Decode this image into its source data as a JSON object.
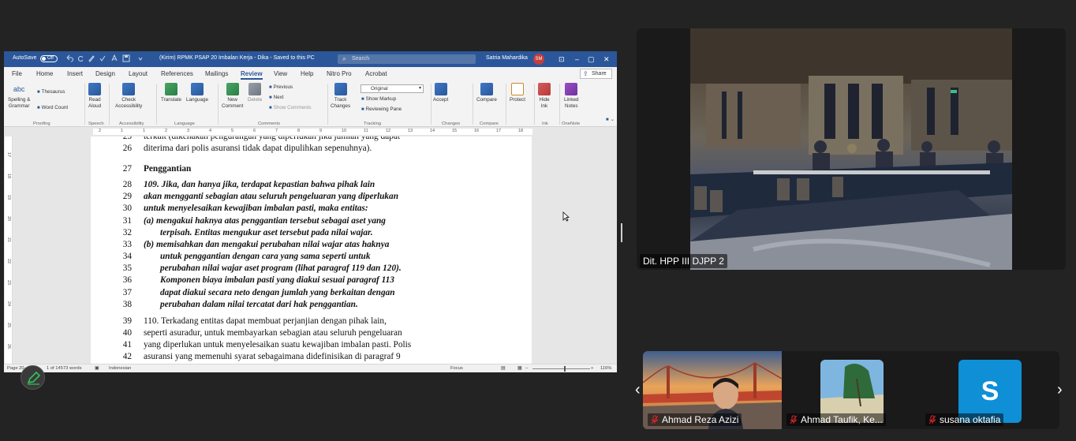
{
  "word": {
    "titlebar": {
      "autosave_label": "AutoSave",
      "autosave_state": "Off",
      "doc_title": "(Kirim) RPMK PSAP 20 Imbalan Kerja - Dika  -  Saved to this PC",
      "search_placeholder": "Search",
      "user_name": "Satria Mahardika",
      "user_initials": "SM"
    },
    "tabs": [
      "File",
      "Home",
      "Insert",
      "Design",
      "Layout",
      "References",
      "Mailings",
      "Review",
      "View",
      "Help",
      "Nitro Pro",
      "Acrobat"
    ],
    "active_tab": "Review",
    "share_label": "Share",
    "ribbon": {
      "proofing": {
        "spelling": "Spelling &",
        "spelling2": "Grammar",
        "thesaurus": "Thesaurus",
        "word_count": "Word Count",
        "group": "Proofing"
      },
      "speech": {
        "read_aloud": "Read",
        "read_aloud2": "Aloud",
        "group": "Speech"
      },
      "accessibility": {
        "check": "Check",
        "check2": "Accessibility",
        "group": "Accessibility"
      },
      "language": {
        "translate": "Translate",
        "language": "Language",
        "group": "Language"
      },
      "comments": {
        "new_comment": "New",
        "new_comment2": "Comment",
        "delete": "Delete",
        "previous": "Previous",
        "next": "Next",
        "show_comments": "Show Comments",
        "group": "Comments"
      },
      "tracking": {
        "track_changes": "Track",
        "track_changes2": "Changes",
        "markup_view": "Original",
        "show_markup": "Show Markup",
        "reviewing_pane": "Reviewing Pane",
        "group": "Tracking"
      },
      "changes": {
        "accept": "Accept",
        "group": "Changes"
      },
      "compare": {
        "compare": "Compare",
        "group": "Compare"
      },
      "protect": {
        "protect": "Protect"
      },
      "ink": {
        "hide_ink": "Hide",
        "hide_ink2": "Ink",
        "group": "Ink"
      },
      "onenote": {
        "linked_notes": "Linked",
        "linked_notes2": "Notes",
        "group": "OneNote"
      }
    },
    "ruler_ticks": [
      "2",
      "1",
      "1",
      "2",
      "3",
      "4",
      "5",
      "6",
      "7",
      "8",
      "9",
      "10",
      "11",
      "12",
      "13",
      "14",
      "15",
      "16",
      "17",
      "18"
    ],
    "vruler_ticks": [
      "17",
      "18",
      "19",
      "20",
      "21",
      "22",
      "23",
      "24",
      "25",
      "26"
    ],
    "document": {
      "lines": [
        {
          "n": "25",
          "t": "terkait (dikenakan pengurangan yang diperlukan jika jumlah yang dapat",
          "style": "",
          "indent": false
        },
        {
          "n": "26",
          "t": "diterima dari polis asuransi tidak dapat dipulihkan sepenuhnya).",
          "style": "",
          "indent": false
        },
        {
          "n": "27",
          "t": "Penggantian",
          "style": "b",
          "indent": false
        },
        {
          "n": "28",
          "t": "109.   Jika, dan hanya jika, terdapat kepastian bahwa pihak lain",
          "style": "bi",
          "indent": false
        },
        {
          "n": "29",
          "t": "akan mengganti sebagian atau seluruh pengeluaran yang diperlukan",
          "style": "bi",
          "indent": false
        },
        {
          "n": "30",
          "t": "untuk menyelesaikan kewajiban imbalan pasti, maka entitas:",
          "style": "bi",
          "indent": false
        },
        {
          "n": "31",
          "t": "(a)  mengakui haknya atas penggantian tersebut sebagai aset yang",
          "style": "bi",
          "indent": false
        },
        {
          "n": "32",
          "t": "terpisah. Entitas mengukur aset tersebut pada nilai wajar.",
          "style": "bi",
          "indent": true
        },
        {
          "n": "33",
          "t": "(b)  memisahkan dan mengakui perubahan nilai wajar atas haknya",
          "style": "bi",
          "indent": false
        },
        {
          "n": "34",
          "t": "untuk penggantian dengan cara yang sama seperti untuk",
          "style": "bi",
          "indent": true
        },
        {
          "n": "35",
          "t": "perubahan nilai wajar aset program (lihat paragraf 119 dan 120).",
          "style": "bi",
          "indent": true
        },
        {
          "n": "36",
          "t": "Komponen biaya imbalan pasti yang diakui sesuai paragraf 113",
          "style": "bi",
          "indent": true
        },
        {
          "n": "37",
          "t": "dapat diakui secara neto dengan jumlah yang berkaitan dengan",
          "style": "bi",
          "indent": true
        },
        {
          "n": "38",
          "t": "perubahan dalam nilai tercatat dari hak penggantian.",
          "style": "bi",
          "indent": true
        },
        {
          "n": "39",
          "t": "110.   Terkadang entitas dapat membuat perjanjian dengan pihak lain,",
          "style": "",
          "indent": false
        },
        {
          "n": "40",
          "t": "seperti asuradur, untuk membayarkan sebagian atau seluruh pengeluaran",
          "style": "",
          "indent": false
        },
        {
          "n": "41",
          "t": "yang diperlukan untuk menyelesaikan suatu kewajiban imbalan pasti. Polis",
          "style": "",
          "indent": false
        },
        {
          "n": "42",
          "t": "asuransi yang memenuhi syarat sebagaimana didefinisikan di paragraf 9",
          "style": "",
          "indent": false
        }
      ]
    },
    "status": {
      "page": "Page 20",
      "words": "1 of 14573 words",
      "language": "Indonesian",
      "focus": "Focus",
      "zoom": "116%"
    }
  },
  "zoom": {
    "main_video_label": "Dit. HPP III DJPP 2",
    "participants": [
      {
        "name": "Ahmad Reza Azizi",
        "muted": true
      },
      {
        "name": "Ahmad Taufik, Ke...",
        "muted": true
      },
      {
        "name": "susana oktafia",
        "muted": true,
        "avatar_letter": "S"
      }
    ],
    "colors": {
      "avatar_blue": "#0e8fd6",
      "word_blue": "#2b579a",
      "mute_red": "#e02828"
    }
  }
}
